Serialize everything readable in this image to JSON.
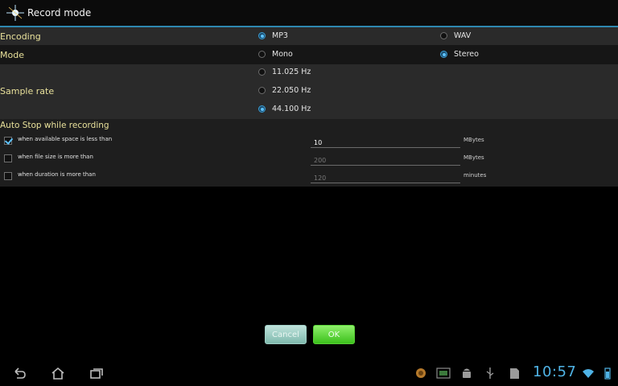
{
  "title": "Record mode",
  "encoding": {
    "label": "Encoding",
    "options": [
      "MP3",
      "WAV"
    ],
    "selected": "MP3"
  },
  "mode": {
    "label": "Mode",
    "options": [
      "Mono",
      "Stereo"
    ],
    "selected": "Stereo"
  },
  "sample_rate": {
    "label": "Sample rate",
    "options": [
      "11.025 Hz",
      "22.050 Hz",
      "44.100 Hz"
    ],
    "selected": "44.100 Hz"
  },
  "auto_stop": {
    "header": "Auto Stop while recording",
    "rows": [
      {
        "label": "when available space is less than",
        "value": "10",
        "unit": "MBytes",
        "checked": true
      },
      {
        "label": "when file size is more than",
        "value": "200",
        "unit": "MBytes",
        "checked": false
      },
      {
        "label": "when duration is more than",
        "value": "120",
        "unit": "minutes",
        "checked": false
      }
    ]
  },
  "buttons": {
    "cancel": "Cancel",
    "ok": "OK"
  },
  "status": {
    "time": "10:57"
  },
  "colors": {
    "accent": "#2e87b0",
    "label_yellow": "#e8e09a",
    "time_blue": "#4fb3e6"
  }
}
